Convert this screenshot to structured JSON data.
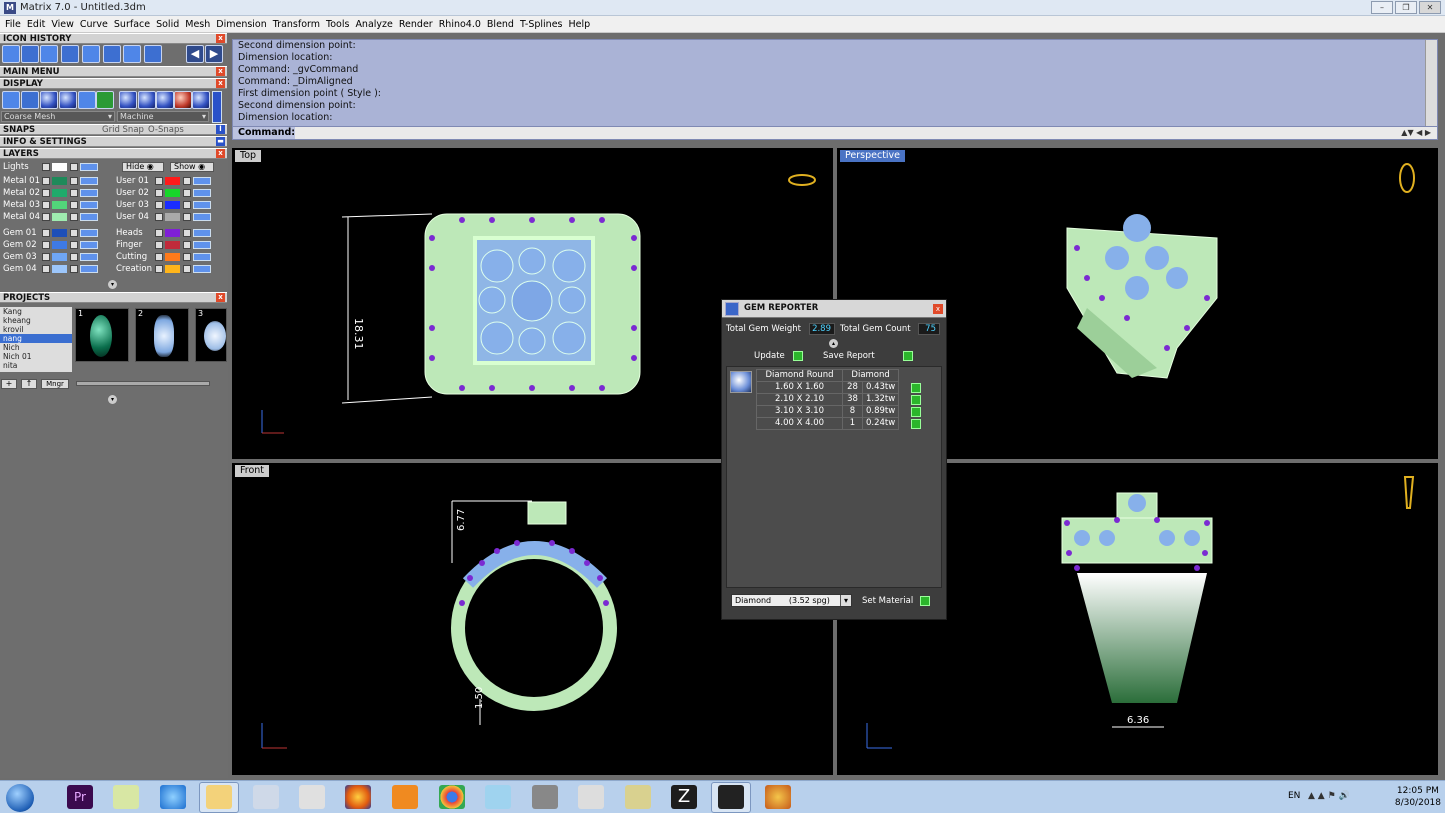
{
  "window": {
    "title": "Matrix 7.0 - Untitled.3dm"
  },
  "menu": [
    "File",
    "Edit",
    "View",
    "Curve",
    "Surface",
    "Solid",
    "Mesh",
    "Dimension",
    "Transform",
    "Tools",
    "Analyze",
    "Render",
    "Rhino4.0",
    "Blend",
    "T-Splines",
    "Help"
  ],
  "panels": {
    "icon_history": "ICON HISTORY",
    "main_menu": "MAIN MENU",
    "display": "DISPLAY",
    "snaps": "SNAPS",
    "info": "INFO & SETTINGS",
    "layers": "LAYERS",
    "projects": "PROJECTS"
  },
  "display": {
    "mesh": "Coarse Mesh",
    "material": "Machine"
  },
  "snaps": {
    "grid": "Grid Snap",
    "osnap": "O-Snaps"
  },
  "layers": {
    "lights": "Lights",
    "hide": "Hide",
    "show": "Show",
    "left": [
      {
        "name": "Metal 01",
        "color": "#1e8a5a"
      },
      {
        "name": "Metal 02",
        "color": "#1faa6b"
      },
      {
        "name": "Metal 03",
        "color": "#52d67a"
      },
      {
        "name": "Metal 04",
        "color": "#9fecb0"
      },
      {
        "name": "Gem 01",
        "color": "#1d4fb8"
      },
      {
        "name": "Gem 02",
        "color": "#3e7ae6"
      },
      {
        "name": "Gem 03",
        "color": "#6fa6f5"
      },
      {
        "name": "Gem 04",
        "color": "#9cc6fb"
      }
    ],
    "right": [
      {
        "name": "User 01",
        "color": "#ff1a1a"
      },
      {
        "name": "User 02",
        "color": "#18d62a"
      },
      {
        "name": "User 03",
        "color": "#1a2cff"
      },
      {
        "name": "User 04",
        "color": "#a9a9a9"
      },
      {
        "name": "Heads",
        "color": "#7f1fd6"
      },
      {
        "name": "Finger",
        "color": "#c12a3b"
      },
      {
        "name": "Cutting",
        "color": "#ff7a1a"
      },
      {
        "name": "Creation",
        "color": "#ffb51a"
      }
    ]
  },
  "projects": {
    "list": [
      "Kang",
      "kheang",
      "krovil",
      "nang",
      "Nich",
      "Nich 01",
      "nita"
    ],
    "selected": "nang",
    "thumbs": [
      "1",
      "2",
      "3"
    ],
    "mngr": "Mngr"
  },
  "command": {
    "history": [
      "Second dimension point:",
      "Dimension location:",
      "Command: _gvCommand",
      "Command: _DimAligned",
      "First dimension point ( Style ):",
      "Second dimension point:",
      "Dimension location:"
    ],
    "label": "Command:"
  },
  "viewports": {
    "top": "Top",
    "perspective": "Perspective",
    "front": "Front",
    "dims": {
      "top": "18.31",
      "front_h": "6.77",
      "front_b": "1.50",
      "right_w": "6.36"
    }
  },
  "gem_reporter": {
    "title": "GEM REPORTER",
    "weight_label": "Total Gem Weight",
    "weight": "2.89",
    "count_label": "Total Gem Count",
    "count": "75",
    "update": "Update",
    "save": "Save Report",
    "col1": "Diamond Round",
    "col2": "Diamond",
    "rows": [
      {
        "size": "1.60 X 1.60",
        "count": "28",
        "tw": "0.43tw"
      },
      {
        "size": "2.10 X 2.10",
        "count": "38",
        "tw": "1.32tw"
      },
      {
        "size": "3.10 X 3.10",
        "count": "8",
        "tw": "0.89tw"
      },
      {
        "size": "4.00 X 4.00",
        "count": "1",
        "tw": "0.24tw"
      }
    ],
    "material": "Diamond       (3.52 spg)",
    "set_material": "Set Material"
  },
  "taskbar": {
    "lang": "EN",
    "time": "12:05 PM",
    "date": "8/30/2018"
  }
}
